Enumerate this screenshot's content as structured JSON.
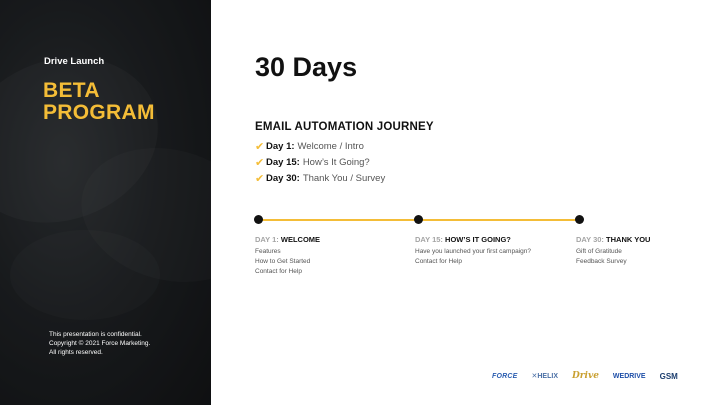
{
  "sidebar": {
    "subtitle": "Drive Launch",
    "title_lines": [
      "BETA",
      "PROGRAM"
    ],
    "footer_lines": [
      "This presentation is confidential.",
      "Copyright © 2021 Force Marketing.",
      "All rights reserved."
    ]
  },
  "main": {
    "title": "30 Days",
    "journey_title": "EMAIL AUTOMATION JOURNEY",
    "checklist": [
      {
        "day": "Day 1:",
        "text": "Welcome / Intro"
      },
      {
        "day": "Day 15:",
        "text": "How’s It Going?"
      },
      {
        "day": "Day 30:",
        "text": "Thank You / Survey"
      }
    ],
    "timeline": [
      {
        "day_label": "DAY 1:",
        "heading": "WELCOME",
        "lines": [
          "Features",
          "How to Get Started",
          "Contact for Help"
        ]
      },
      {
        "day_label": "DAY 15:",
        "heading": "HOW’S IT GOING?",
        "lines": [
          "Have you launched your first campaign?",
          "Contact for Help"
        ]
      },
      {
        "day_label": "DAY 30:",
        "heading": "THANK YOU",
        "lines": [
          "Gift of Gratitude",
          "Feedback Survey"
        ]
      }
    ]
  },
  "logos": [
    "FORCE",
    "HELIX",
    "Drive",
    "WEDRIVE",
    "GSM"
  ],
  "colors": {
    "accent": "#f4bd37",
    "sidebar_bg": "#1b1e21",
    "text": "#111111"
  }
}
